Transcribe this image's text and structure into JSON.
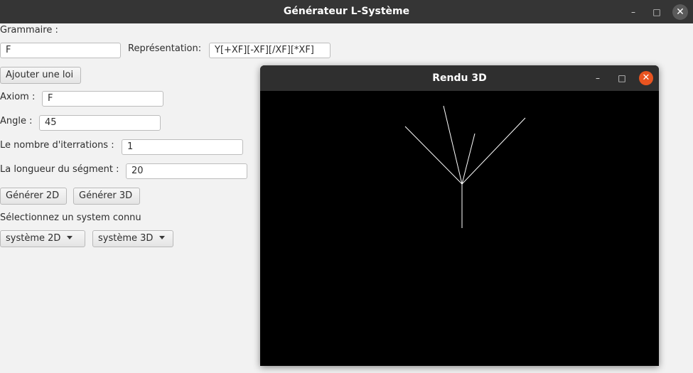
{
  "main_window": {
    "title": "Générateur L-Système",
    "controls": {
      "minimize": "–",
      "maximize": "□",
      "close": "✕"
    }
  },
  "form": {
    "grammaire_label": "Grammaire :",
    "grammaire_value": "F",
    "representation_label": "Représentation:",
    "representation_value": "Y[+XF][-XF][/XF][*XF]",
    "add_rule_button": "Ajouter une loi",
    "axiom_label": "Axiom :",
    "axiom_value": "F",
    "angle_label": "Angle :",
    "angle_value": "45",
    "iterations_label": "Le nombre d'iterrations :",
    "iterations_value": "1",
    "segment_length_label": "La longueur du ségment :",
    "segment_length_value": "20",
    "generate_2d_button": "Générer 2D",
    "generate_3d_button": "Générer 3D",
    "known_system_label": "Sélectionnez un system connu",
    "system_2d_select": "système 2D",
    "system_3d_select": "système 3D"
  },
  "render_window": {
    "title": "Rendu 3D",
    "controls": {
      "minimize": "–",
      "maximize": "□",
      "close": "✕"
    },
    "background_color": "#000000",
    "line_color": "#ffffff"
  }
}
